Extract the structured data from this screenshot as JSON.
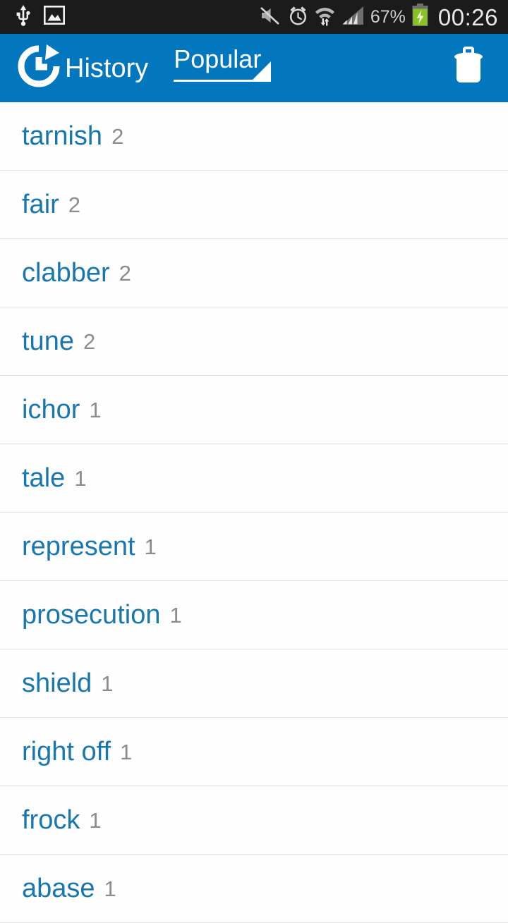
{
  "status_bar": {
    "left_icons": [
      "usb-icon",
      "screenshot-image-icon"
    ],
    "right_icons": [
      "volume-muted-icon",
      "alarm-clock-icon",
      "wifi-icon",
      "cellular-signal-icon",
      "battery-charging-icon"
    ],
    "battery_percent": "67%",
    "clock": "00:26",
    "background_color": "#1b1b1b"
  },
  "app_bar": {
    "icon": "history-clock-icon",
    "title": "History",
    "spinner": {
      "selected": "Popular",
      "caret_icon": "spinner-caret-icon"
    },
    "delete_icon": "trash-can-icon",
    "background_color": "#0377bd"
  },
  "list": {
    "word_color": "#1877ae",
    "count_color": "#8c8c8c",
    "divider_color": "#e2e2e2",
    "items": [
      {
        "word": "tarnish",
        "count": "2"
      },
      {
        "word": "fair",
        "count": "2"
      },
      {
        "word": "clabber",
        "count": "2"
      },
      {
        "word": "tune",
        "count": "2"
      },
      {
        "word": "ichor",
        "count": "1"
      },
      {
        "word": "tale",
        "count": "1"
      },
      {
        "word": "represent",
        "count": "1"
      },
      {
        "word": "prosecution",
        "count": "1"
      },
      {
        "word": "shield",
        "count": "1"
      },
      {
        "word": "right off",
        "count": "1"
      },
      {
        "word": "frock",
        "count": "1"
      },
      {
        "word": "abase",
        "count": "1"
      }
    ]
  }
}
